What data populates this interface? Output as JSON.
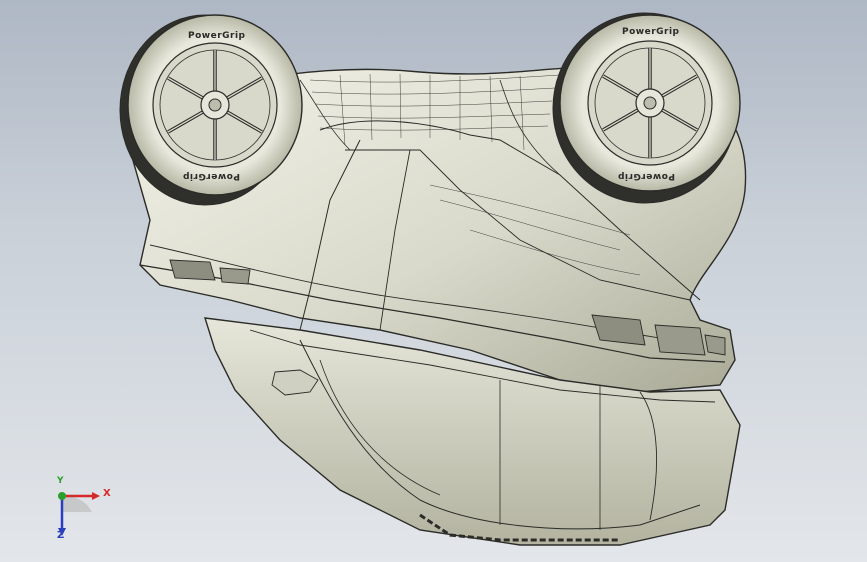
{
  "viewport": {
    "background_top": "#aeb7c4",
    "background_bottom": "#e3e6ea",
    "model_fill": "#e4e4d8",
    "model_shade": "#b9b9a8",
    "edge_color": "#2b2b28"
  },
  "tires": {
    "left": {
      "text_top": "PowerGrip",
      "text_bottom": "PowerGrip"
    },
    "right": {
      "text_top": "PowerGrip",
      "text_bottom": "PowerGrip"
    }
  },
  "triad": {
    "x_label": "X",
    "y_label": "Y",
    "z_label": "Z",
    "x_color": "#d42a2a",
    "y_color": "#2aa02a",
    "z_color": "#2a3fc0"
  }
}
